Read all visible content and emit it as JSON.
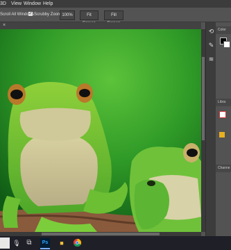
{
  "menu": {
    "items": [
      "3D",
      "View",
      "Window",
      "Help"
    ]
  },
  "options": {
    "scroll_all_windows": "Scroll All Windows",
    "scrubby_zoom": "Scrubby Zoom",
    "zoom_100": "100%",
    "fit_screen": "Fit Screen",
    "fill_screen": "Fill Screen"
  },
  "panels": {
    "color_title": "Color",
    "libraries_title": "Libra",
    "channels_title": "Channe"
  },
  "colors": {
    "app_bg": "#535353",
    "menubar_bg": "#3c3c3c",
    "taskbar_bg": "#1f1f28",
    "ps_blue": "#31a8ff"
  },
  "icons": {
    "close_tab": "close-icon",
    "search": "search-icon",
    "task_view": "task-view-icon",
    "photoshop": "photoshop-icon",
    "file_explorer": "folder-icon",
    "chrome": "chrome-icon"
  }
}
